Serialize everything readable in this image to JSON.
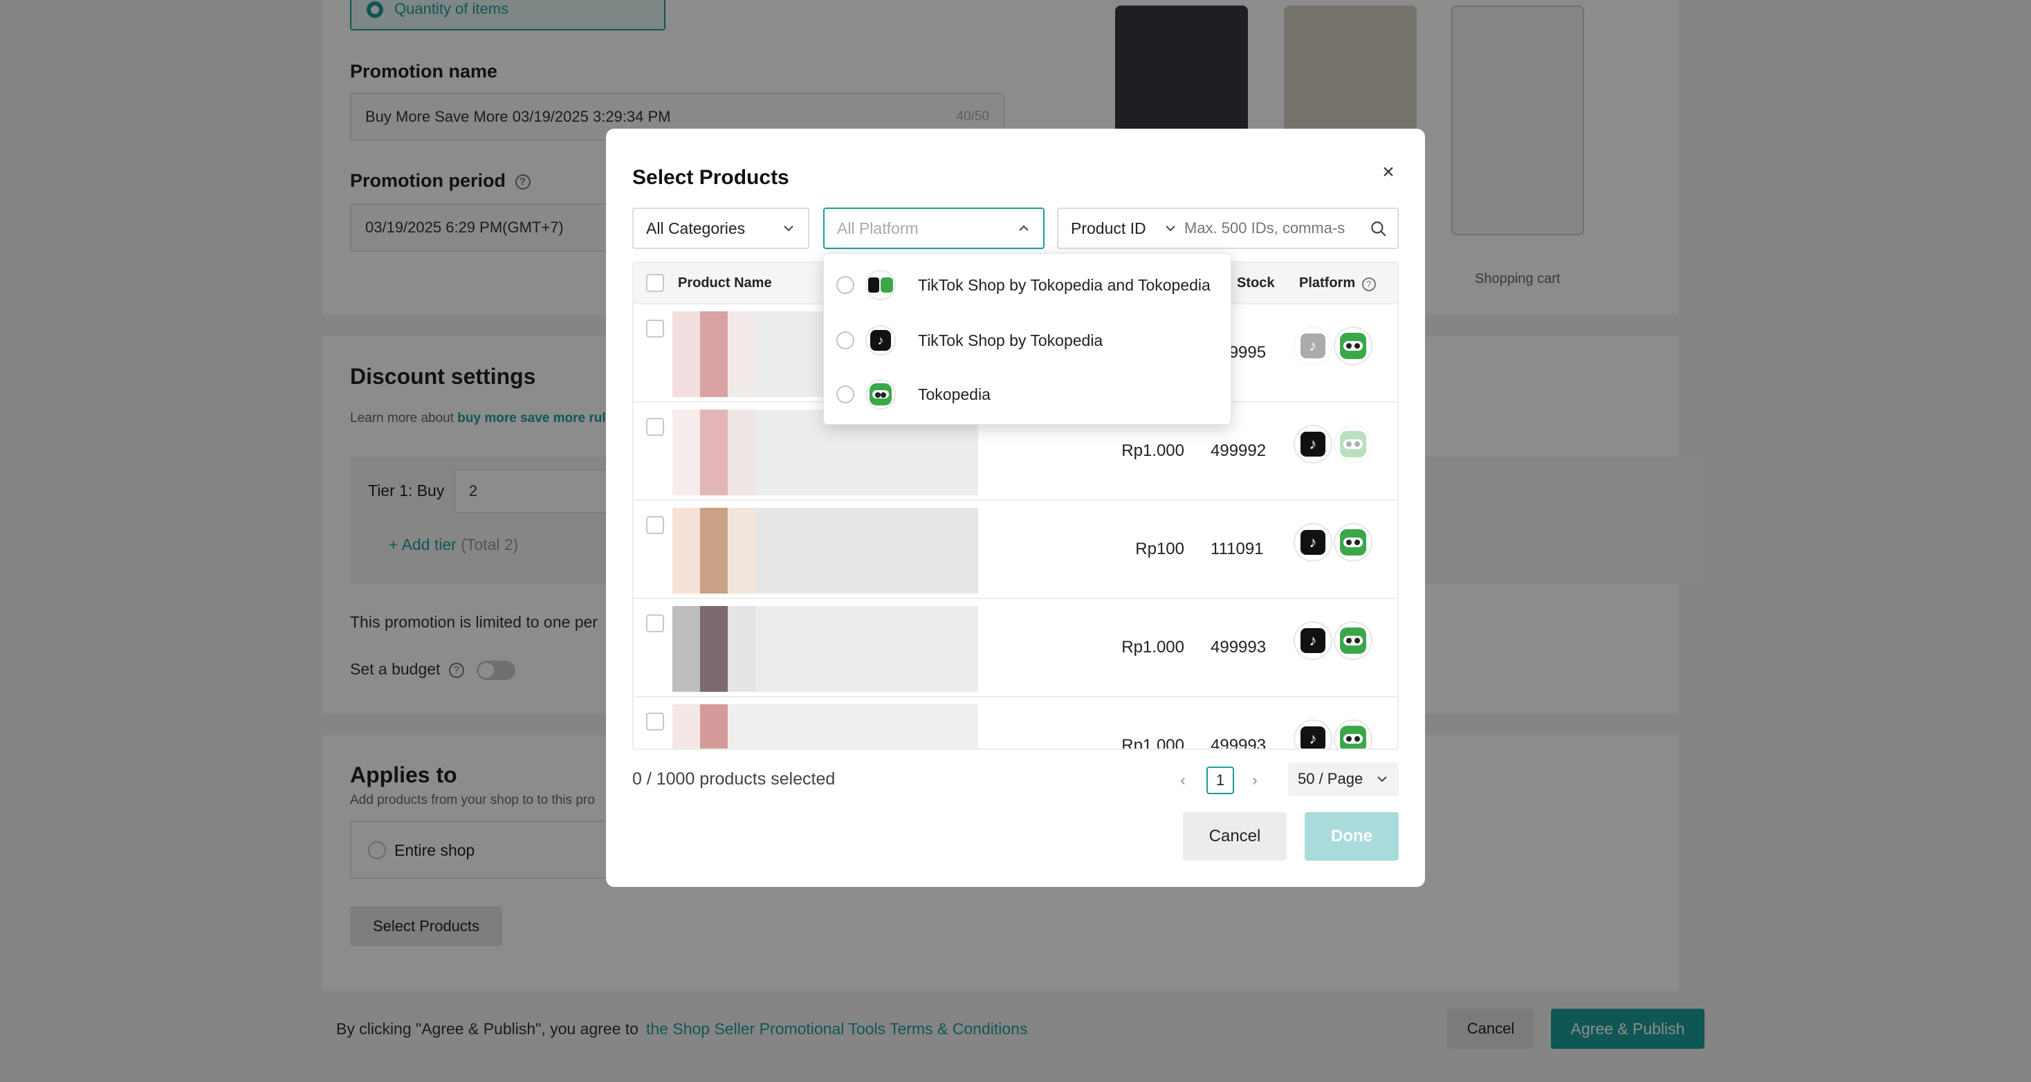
{
  "background": {
    "radio_option": "Quantity of items",
    "promotion_name_label": "Promotion name",
    "promotion_name_value": "Buy More Save More 03/19/2025 3:29:34 PM",
    "promotion_name_count": "40/50",
    "promotion_period_label": "Promotion period",
    "promotion_period_value": "03/19/2025 6:29 PM(GMT+7)",
    "preview_caption": "Shopping cart",
    "discount_settings_title": "Discount settings",
    "learn_more_prefix": "Learn more about",
    "learn_more_link": "buy more save more rul",
    "tier_label": "Tier 1: Buy",
    "tier_value": "2",
    "add_tier": "Add tier",
    "add_tier_total": "(Total 2)",
    "limit_text": "This promotion is limited to one per",
    "budget_label": "Set a budget",
    "applies_to_title": "Applies to",
    "applies_to_desc": "Add products from your shop to to this pro",
    "entire_shop": "Entire shop",
    "select_products_btn": "Select Products",
    "agree_prefix": "By clicking \"Agree & Publish\", you agree to",
    "terms_link": "the Shop Seller Promotional Tools Terms & Conditions",
    "footer_cancel": "Cancel",
    "footer_publish": "Agree & Publish"
  },
  "modal": {
    "title": "Select Products",
    "close": "×",
    "filters": {
      "categories": "All Categories",
      "platform_placeholder": "All Platform",
      "id_type": "Product ID",
      "search_placeholder": "Max. 500 IDs, comma-s"
    },
    "table": {
      "headers": {
        "name": "Product Name",
        "stock": "Stock",
        "platform": "Platform"
      },
      "rows": [
        {
          "price": "",
          "stock": "499995"
        },
        {
          "price": "Rp1.000",
          "stock": "499992"
        },
        {
          "price": "Rp100",
          "stock": "111091"
        },
        {
          "price": "Rp1.000",
          "stock": "499993"
        },
        {
          "price": "Rp1.000",
          "stock": "499993"
        }
      ]
    },
    "platform_dropdown": [
      {
        "label": "TikTok Shop by Tokopedia and Tokopedia",
        "icon": "tiktok-tokopedia-icon"
      },
      {
        "label": "TikTok Shop by Tokopedia",
        "icon": "tiktok-icon"
      },
      {
        "label": "Tokopedia",
        "icon": "tokopedia-icon"
      }
    ],
    "selected_count": "0 / 1000 products selected",
    "current_page": "1",
    "page_size": "50 / Page",
    "cancel": "Cancel",
    "done": "Done"
  },
  "colors": {
    "accent": "#1a9e9a",
    "done_disabled": "#a8dbd9",
    "overlay": "rgba(0,0,0,0.45)"
  }
}
